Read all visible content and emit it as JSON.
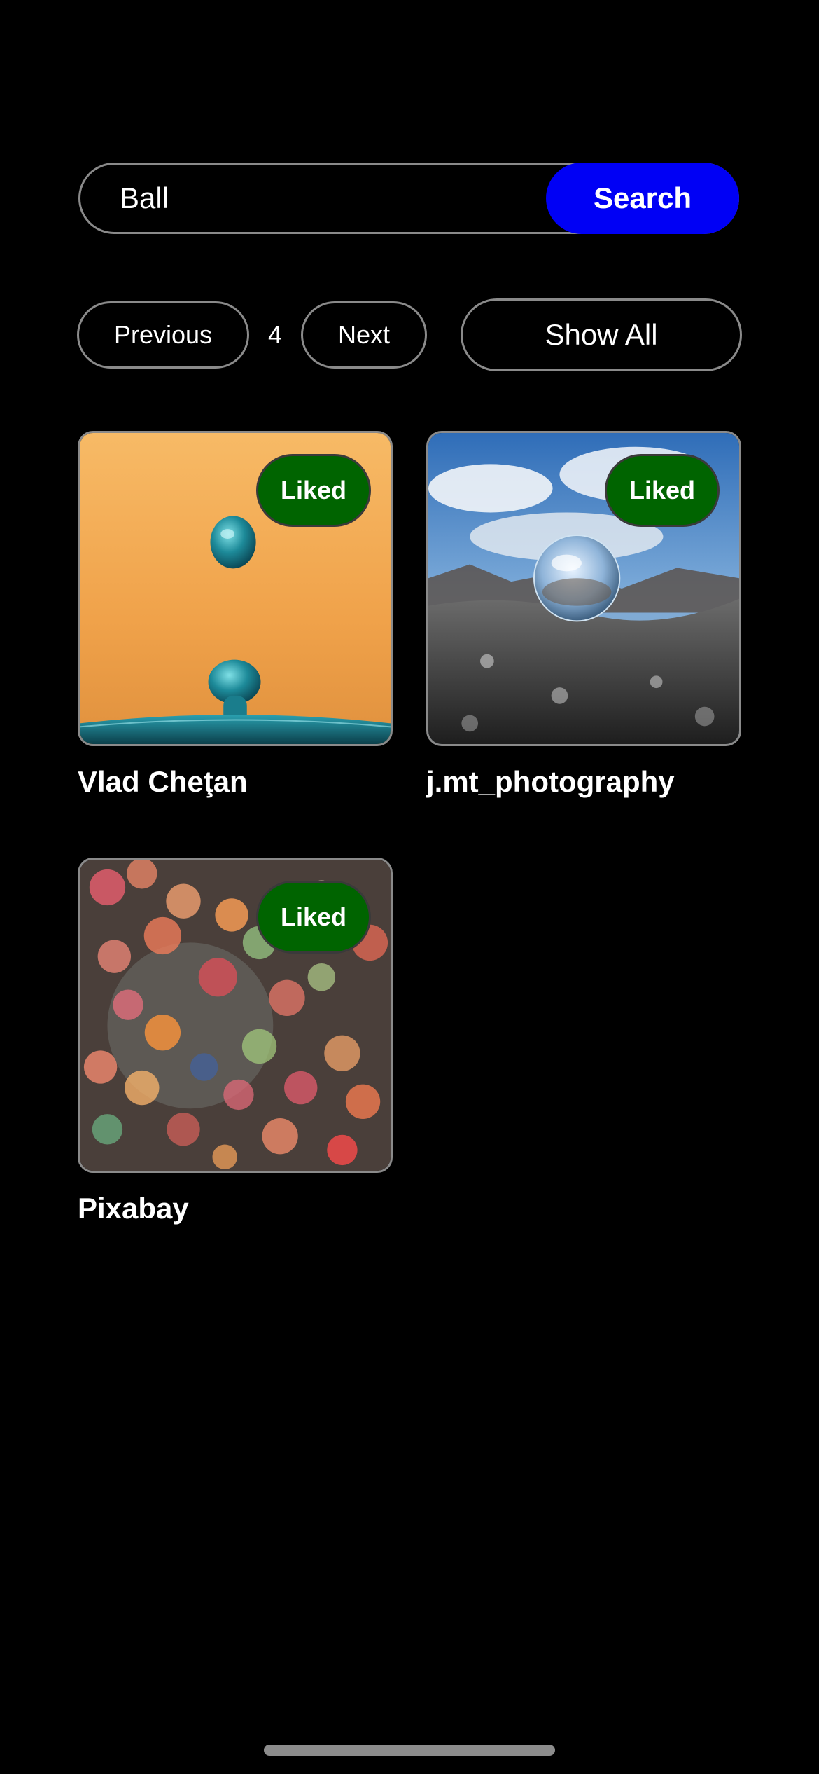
{
  "search": {
    "value": "Ball",
    "button_label": "Search",
    "button_color": "#0000f5"
  },
  "pagination": {
    "previous_label": "Previous",
    "page": "4",
    "next_label": "Next",
    "show_all_label": "Show All"
  },
  "results": [
    {
      "photographer": "Vlad Cheţan",
      "badge": "Liked",
      "image": "water-droplets-orange-photo"
    },
    {
      "photographer": "j.mt_photography",
      "badge": "Liked",
      "image": "crystal-ball-on-rock-photo"
    },
    {
      "photographer": "Pixabay",
      "badge": "Liked",
      "image": "bokeh-lights-photo"
    }
  ],
  "colors": {
    "background": "#000000",
    "liked_badge": "#006400",
    "border": "#8a8a8a"
  }
}
